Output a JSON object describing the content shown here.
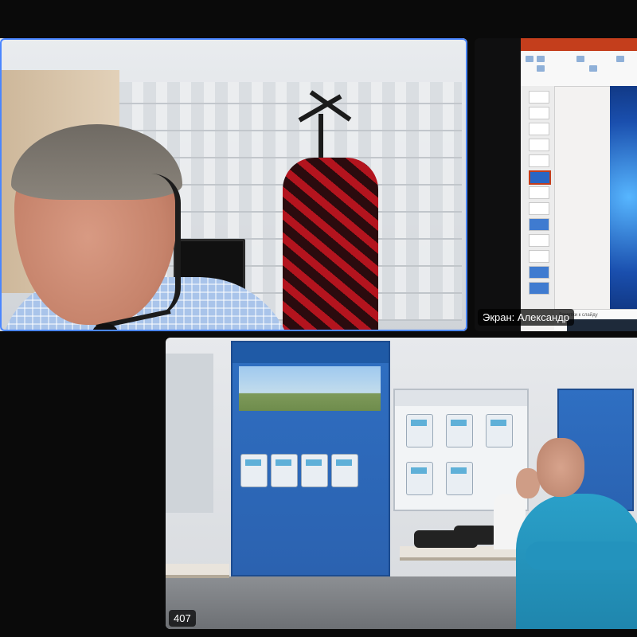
{
  "tiles": {
    "presenter": {
      "active_speaker": true
    },
    "screen_share": {
      "label": "Экран: Александр",
      "notes_placeholder": "Заметки к слайду"
    },
    "room": {
      "count_badge": "407"
    }
  },
  "colors": {
    "background": "#000000",
    "active_border": "#4a86ff",
    "ppt_accent": "#c43e1c"
  },
  "icons": {
    "headset": "headset-icon",
    "cursor": "mouse-cursor-icon"
  }
}
